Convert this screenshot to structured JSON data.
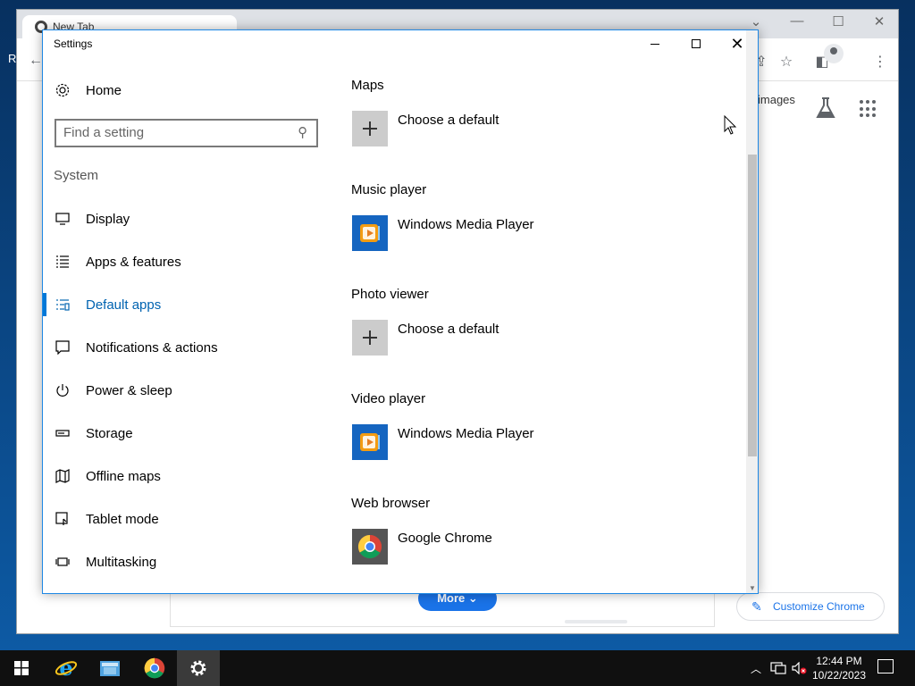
{
  "desktop": {
    "edge_text": "R"
  },
  "chrome": {
    "tab_title": "New Tab",
    "images_link": "images",
    "more_button": "More",
    "customize_button": "Customize Chrome"
  },
  "settings": {
    "window_title": "Settings",
    "home_label": "Home",
    "search_placeholder": "Find a setting",
    "section_header": "System",
    "nav": [
      {
        "label": "Display",
        "icon": "monitor-icon"
      },
      {
        "label": "Apps & features",
        "icon": "apps-list-icon"
      },
      {
        "label": "Default apps",
        "icon": "default-apps-icon",
        "active": true
      },
      {
        "label": "Notifications & actions",
        "icon": "message-icon"
      },
      {
        "label": "Power & sleep",
        "icon": "power-icon"
      },
      {
        "label": "Storage",
        "icon": "storage-icon"
      },
      {
        "label": "Offline maps",
        "icon": "map-icon"
      },
      {
        "label": "Tablet mode",
        "icon": "tablet-icon"
      },
      {
        "label": "Multitasking",
        "icon": "multitasking-icon"
      }
    ],
    "defaults": [
      {
        "category": "Maps",
        "app": "Choose a default",
        "icon": "plus-icon"
      },
      {
        "category": "Music player",
        "app": "Windows Media Player",
        "icon": "windows-media-player-icon"
      },
      {
        "category": "Photo viewer",
        "app": "Choose a default",
        "icon": "plus-icon"
      },
      {
        "category": "Video player",
        "app": "Windows Media Player",
        "icon": "windows-media-player-icon"
      },
      {
        "category": "Web browser",
        "app": "Google Chrome",
        "icon": "chrome-icon"
      }
    ],
    "accent_color": "#0078d7"
  },
  "taskbar": {
    "time": "12:44 PM",
    "date": "10/22/2023",
    "apps": [
      "internet-explorer-icon",
      "file-explorer-icon",
      "chrome-icon",
      "settings-gear-icon"
    ]
  }
}
